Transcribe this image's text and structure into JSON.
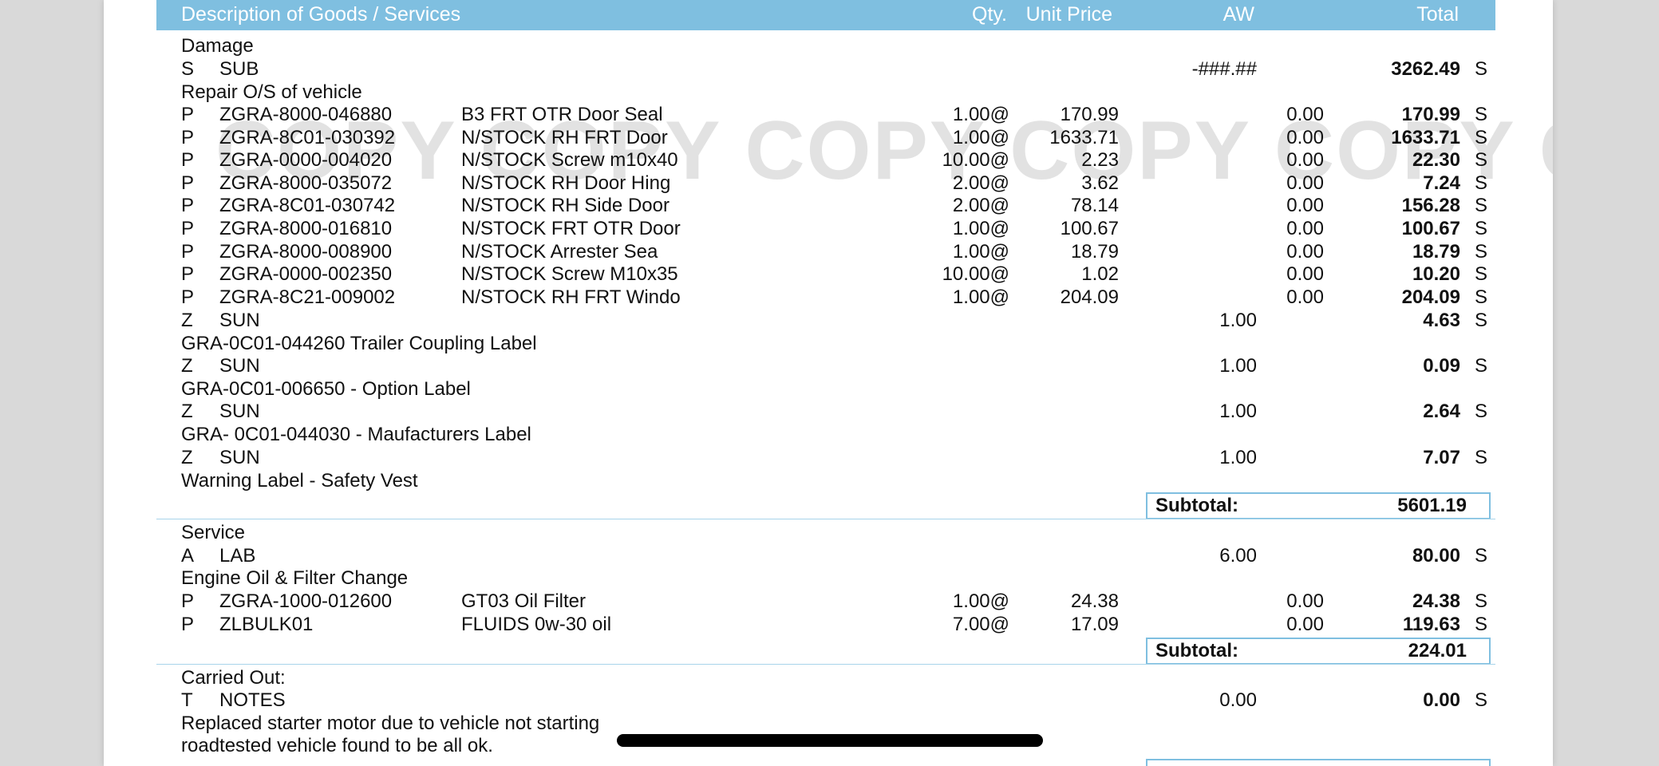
{
  "header": {
    "description": "Description of Goods / Services",
    "qty": "Qty.",
    "unit_price": "Unit Price",
    "aw": "AW",
    "total": "Total"
  },
  "watermark": "COPY COPY COPY COPY COPY COPY",
  "sections": {
    "damage": {
      "title": "Damage",
      "sub_code": "S",
      "sub_name": "SUB",
      "sub_aw": "-###.##",
      "sub_total": "3262.49",
      "sub_tax": "S",
      "note": "Repair O/S of vehicle",
      "parts": [
        {
          "type": "P",
          "code": "ZGRA-8000-046880",
          "desc": "B3 FRT OTR Door Seal",
          "qty": "1.00@",
          "price": "170.99",
          "aw": "0.00",
          "total": "170.99",
          "tax": "S"
        },
        {
          "type": "P",
          "code": "ZGRA-8C01-030392",
          "desc": "N/STOCK RH FRT Door",
          "qty": "1.00@",
          "price": "1633.71",
          "aw": "0.00",
          "total": "1633.71",
          "tax": "S"
        },
        {
          "type": "P",
          "code": "ZGRA-0000-004020",
          "desc": "N/STOCK Screw m10x40",
          "qty": "10.00@",
          "price": "2.23",
          "aw": "0.00",
          "total": "22.30",
          "tax": "S"
        },
        {
          "type": "P",
          "code": "ZGRA-8000-035072",
          "desc": "N/STOCK RH Door Hing",
          "qty": "2.00@",
          "price": "3.62",
          "aw": "0.00",
          "total": "7.24",
          "tax": "S"
        },
        {
          "type": "P",
          "code": "ZGRA-8C01-030742",
          "desc": "N/STOCK RH Side Door",
          "qty": "2.00@",
          "price": "78.14",
          "aw": "0.00",
          "total": "156.28",
          "tax": "S"
        },
        {
          "type": "P",
          "code": "ZGRA-8000-016810",
          "desc": "N/STOCK FRT OTR Door",
          "qty": "1.00@",
          "price": "100.67",
          "aw": "0.00",
          "total": "100.67",
          "tax": "S"
        },
        {
          "type": "P",
          "code": "ZGRA-8000-008900",
          "desc": "N/STOCK Arrester Sea",
          "qty": "1.00@",
          "price": "18.79",
          "aw": "0.00",
          "total": "18.79",
          "tax": "S"
        },
        {
          "type": "P",
          "code": "ZGRA-0000-002350",
          "desc": "N/STOCK Screw M10x35",
          "qty": "10.00@",
          "price": "1.02",
          "aw": "0.00",
          "total": "10.20",
          "tax": "S"
        },
        {
          "type": "P",
          "code": "ZGRA-8C21-009002",
          "desc": "N/STOCK RH FRT Windo",
          "qty": "1.00@",
          "price": "204.09",
          "aw": "0.00",
          "total": "204.09",
          "tax": "S"
        }
      ],
      "suns": [
        {
          "type": "Z",
          "name": "SUN",
          "aw": "1.00",
          "total": "4.63",
          "tax": "S",
          "note": "GRA-0C01-044260 Trailer Coupling Label"
        },
        {
          "type": "Z",
          "name": "SUN",
          "aw": "1.00",
          "total": "0.09",
          "tax": "S",
          "note": "GRA-0C01-006650 - Option Label"
        },
        {
          "type": "Z",
          "name": "SUN",
          "aw": "1.00",
          "total": "2.64",
          "tax": "S",
          "note": "GRA- 0C01-044030 - Maufacturers Label"
        },
        {
          "type": "Z",
          "name": "SUN",
          "aw": "1.00",
          "total": "7.07",
          "tax": "S",
          "note": "Warning Label - Safety Vest"
        }
      ],
      "subtotal_label": "Subtotal:",
      "subtotal_value": "5601.19"
    },
    "service": {
      "title": "Service",
      "lab_code": "A",
      "lab_name": "LAB",
      "lab_aw": "6.00",
      "lab_total": "80.00",
      "lab_tax": "S",
      "note": "Engine Oil & Filter Change",
      "parts": [
        {
          "type": "P",
          "code": "ZGRA-1000-012600",
          "desc": "GT03 Oil Filter",
          "qty": "1.00@",
          "price": "24.38",
          "aw": "0.00",
          "total": "24.38",
          "tax": "S"
        },
        {
          "type": "P",
          "code": "ZLBULK01",
          "desc": "FLUIDS 0w-30 oil",
          "qty": "7.00@",
          "price": "17.09",
          "aw": "0.00",
          "total": "119.63",
          "tax": "S"
        }
      ],
      "subtotal_label": "Subtotal:",
      "subtotal_value": "224.01"
    },
    "carried_out": {
      "title": "Carried Out:",
      "code": "T",
      "name": "NOTES",
      "aw": "0.00",
      "total": "0.00",
      "tax": "S",
      "line1": "Replaced starter motor due to vehicle not starting",
      "line2": "roadtested vehicle found to be all ok."
    }
  }
}
